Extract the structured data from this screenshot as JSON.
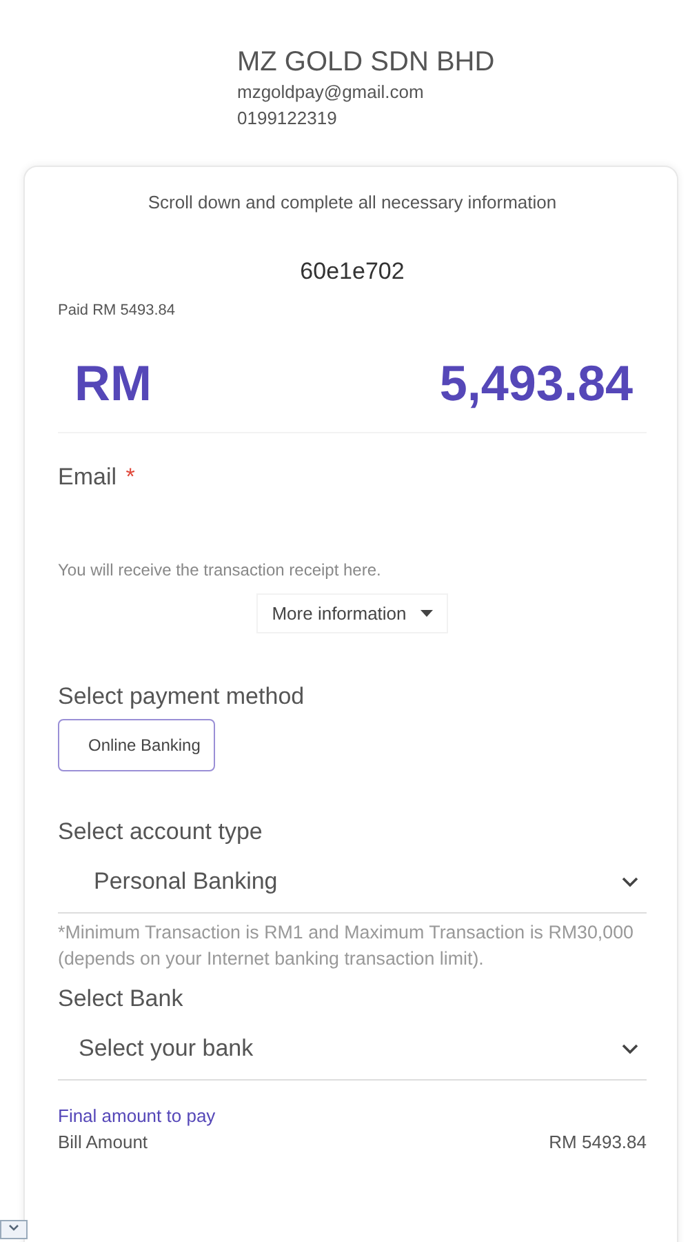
{
  "merchant": {
    "name": "MZ GOLD SDN BHD",
    "email": "mzgoldpay@gmail.com",
    "phone": "0199122319"
  },
  "card": {
    "notice": "Scroll down and complete all necessary information",
    "reference": "60e1e702",
    "paid_note": "Paid RM 5493.84",
    "currency": "RM",
    "amount": "5,493.84"
  },
  "email_field": {
    "label": "Email",
    "required_mark": "*",
    "required": true,
    "helper": "You will receive the transaction receipt here."
  },
  "more_info": {
    "label": "More information",
    "expanded": false
  },
  "payment_method": {
    "label": "Select payment method",
    "options": [
      {
        "label": "Online Banking",
        "selected": true
      }
    ]
  },
  "account_type": {
    "label": "Select account type",
    "value": "Personal Banking"
  },
  "limit_note": "*Minimum Transaction is RM1 and Maximum Transaction is RM30,000 (depends on your Internet banking transaction limit).",
  "bank": {
    "label": "Select Bank",
    "value": "Select your bank"
  },
  "summary": {
    "title": "Final amount to pay",
    "rows": [
      {
        "label": "Bill Amount",
        "value": "RM 5493.84"
      }
    ]
  }
}
